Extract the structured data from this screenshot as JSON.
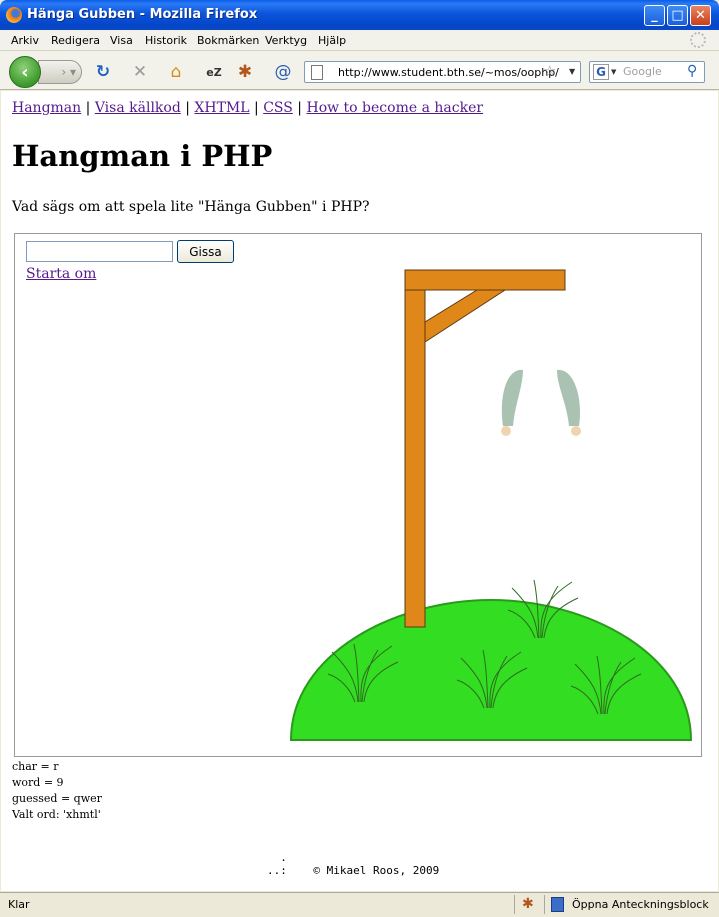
{
  "window": {
    "title": "Hänga Gubben - Mozilla Firefox",
    "min_glyph": "_",
    "max_glyph": "□",
    "close_glyph": "✕"
  },
  "menu": {
    "items": [
      "Arkiv",
      "Redigera",
      "Visa",
      "Historik",
      "Bokmärken",
      "Verktyg",
      "Hjälp"
    ]
  },
  "toolbar": {
    "back_glyph": "‹",
    "forward_glyph": "› ▾",
    "reload_glyph": "↻",
    "stop_glyph": "✕",
    "home_glyph": "⌂",
    "addon1_glyph": "eZ",
    "addon2_glyph": "✱",
    "addon3_glyph": "@",
    "url": "http://www.student.bth.se/~mos/oophp/",
    "star_glyph": "☆",
    "dropdown_glyph": "▼",
    "search_engine_glyph": "G",
    "search_placeholder": "Google",
    "search_glyph": "⚲"
  },
  "page": {
    "nav_links": [
      "Hangman",
      "Visa källkod",
      "XHTML",
      "CSS",
      "How to become a hacker"
    ],
    "separator": " | ",
    "title": "Hangman i PHP",
    "intro": "Vad sägs om att spela lite \"Hänga Gubben\" i PHP?",
    "form": {
      "guess_value": "",
      "guess_button": "Gissa",
      "restart_link": "Starta om"
    },
    "debug": [
      "char = r",
      "word = 9",
      "guessed = qwer",
      "Valt ord: 'xhmtl'"
    ],
    "footer_mark": "  .\n..:",
    "footer_text": "© Mikael Roos, 2009"
  },
  "colors": {
    "gallows": "#e0871a",
    "hill": "#33dd22",
    "hill_edge": "#2a9a1c",
    "grass": "#2f6b1f",
    "arms": "#a9c2b2",
    "hands": "#f0d4b0",
    "link": "#551a8b"
  },
  "status": {
    "text": "Klar",
    "bug_glyph": "✱",
    "notepad": "Öppna Anteckningsblock"
  }
}
